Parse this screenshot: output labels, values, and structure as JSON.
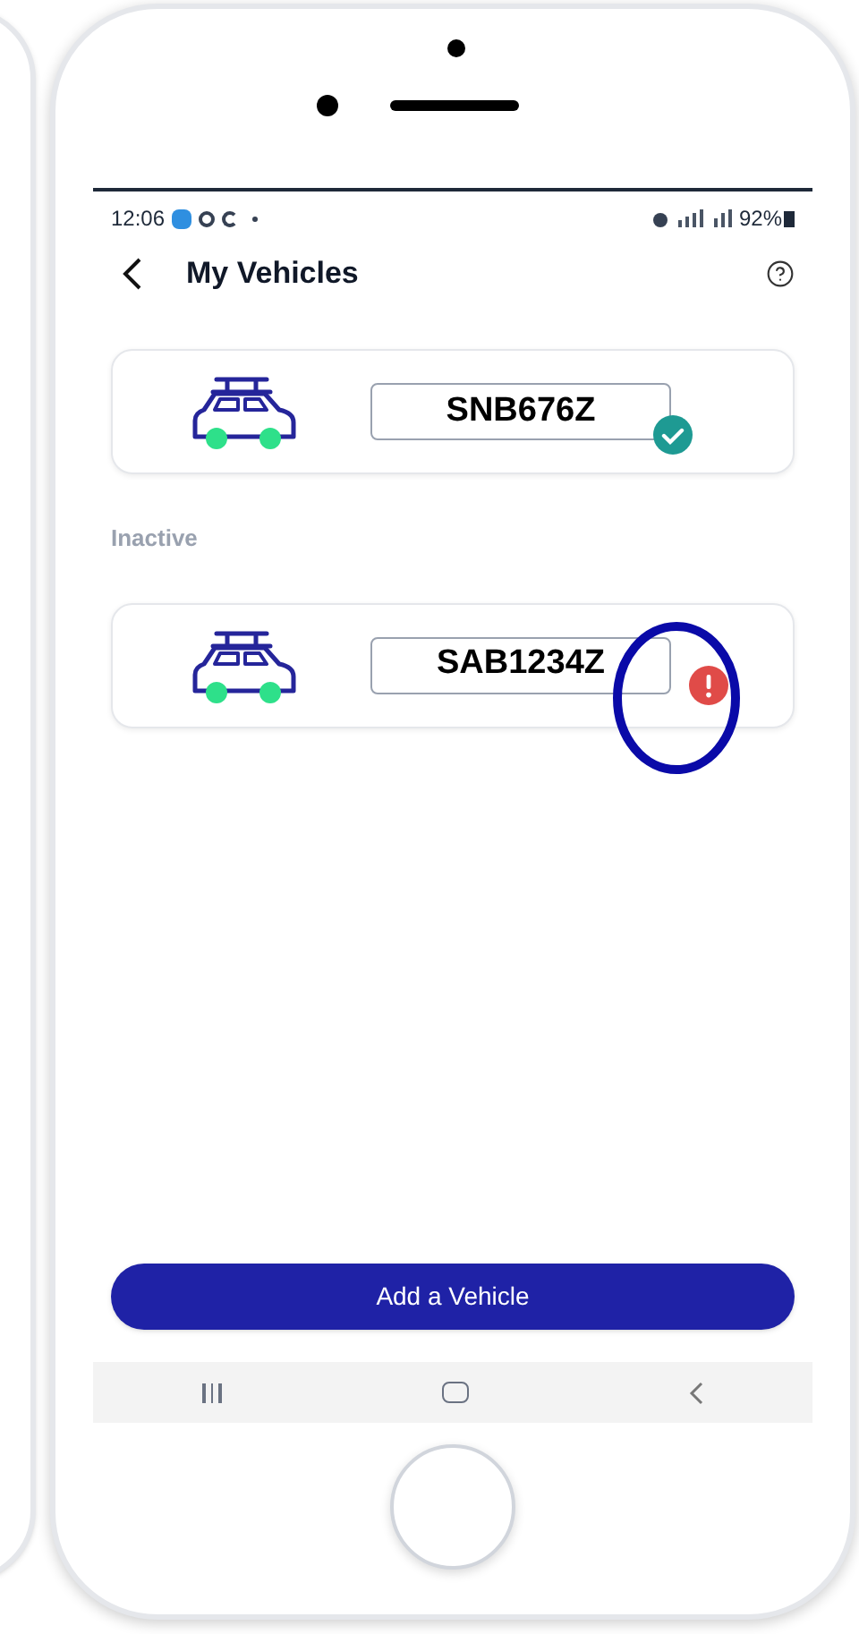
{
  "status_bar": {
    "time": "12:06",
    "battery": "92%"
  },
  "header": {
    "title": "My Vehicles"
  },
  "sections": [
    {
      "vehicles": [
        {
          "plate": "SNB676Z",
          "verified": true,
          "highlighted": false
        }
      ]
    },
    {
      "heading": "Inactive",
      "vehicles": [
        {
          "plate": "SAB1234Z",
          "verified": false,
          "highlighted": true
        }
      ]
    }
  ],
  "primary_button": "Add a Vehicle"
}
